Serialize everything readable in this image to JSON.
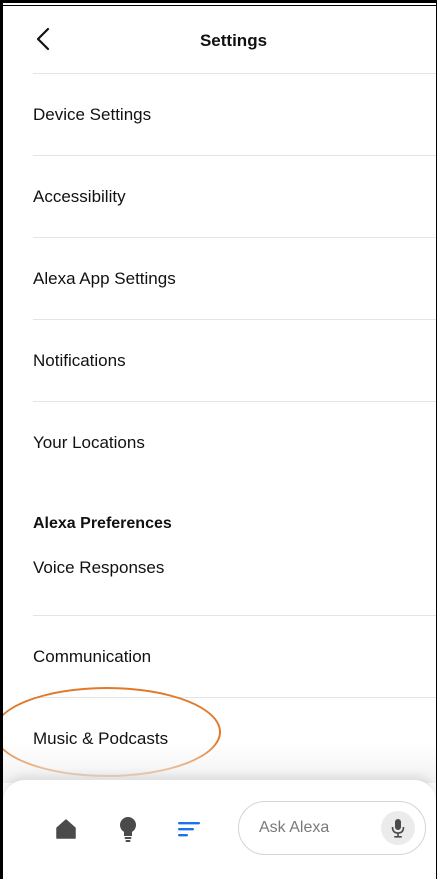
{
  "header": {
    "title": "Settings",
    "back_icon": "chevron-left-icon"
  },
  "settings": {
    "items": [
      {
        "label": "Device Settings"
      },
      {
        "label": "Accessibility"
      },
      {
        "label": "Alexa App Settings"
      },
      {
        "label": "Notifications"
      },
      {
        "label": "Your Locations"
      }
    ]
  },
  "preferences": {
    "header": "Alexa Preferences",
    "items": [
      {
        "label": "Voice Responses"
      },
      {
        "label": "Communication"
      },
      {
        "label": "Music & Podcasts"
      }
    ]
  },
  "bottom_nav": {
    "icons": [
      "home-icon",
      "bulb-icon",
      "more-icon"
    ],
    "active_color": "#1a73e8",
    "inactive_color": "#4a4a4a",
    "ask_placeholder": "Ask Alexa",
    "mic_icon": "microphone-icon"
  },
  "annotation": {
    "highlight_color": "#e07a2a",
    "highlighted_item": "Music & Podcasts"
  }
}
